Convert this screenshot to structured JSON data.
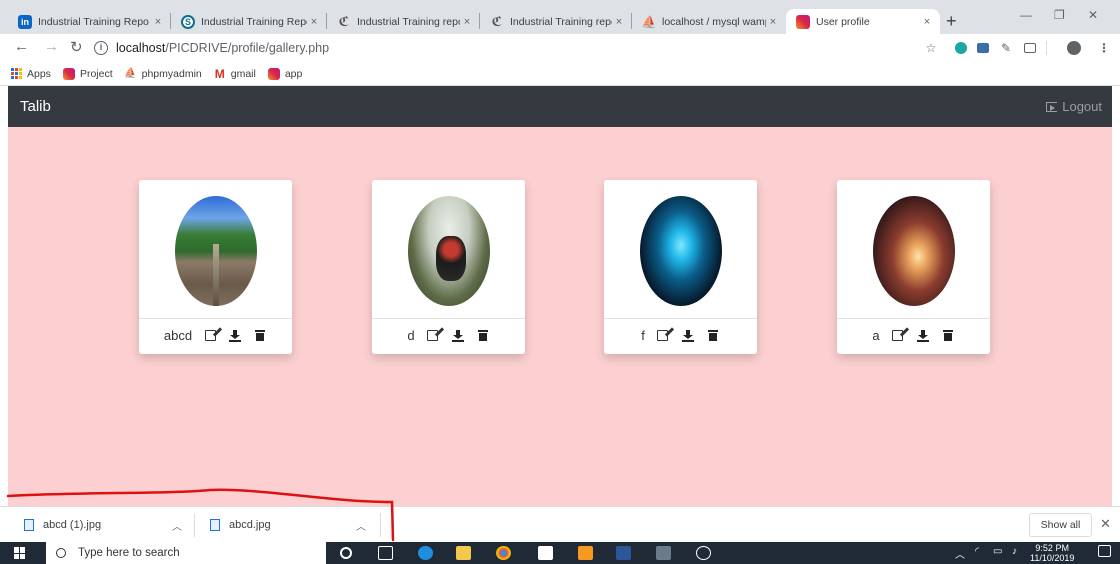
{
  "browser": {
    "tabs": [
      {
        "title": "Industrial Training Repo",
        "icon": "linkedin-icon"
      },
      {
        "title": "Industrial Training Repo",
        "icon": "s-icon"
      },
      {
        "title": "Industrial Training repo",
        "icon": "chegg-icon"
      },
      {
        "title": "Industrial Training repo",
        "icon": "chegg-icon"
      },
      {
        "title": "localhost / mysql wamp",
        "icon": "phpmyadmin-icon"
      },
      {
        "title": "User profile",
        "icon": "instagram-icon",
        "active": true
      }
    ],
    "address": {
      "host": "localhost",
      "path": "/PICDRIVE/profile/gallery.php"
    },
    "bookmarks": [
      "Apps",
      "Project",
      "phpmyadmin",
      "gmail",
      "app"
    ],
    "tab_close_glyph": "×",
    "new_tab_glyph": "+"
  },
  "page": {
    "brand": "Talib",
    "logout_label": "Logout",
    "background_color": "#fcd0d0",
    "navbar_color": "#343a40",
    "cards": [
      {
        "name": "abcd"
      },
      {
        "name": "d"
      },
      {
        "name": "f"
      },
      {
        "name": "a"
      }
    ]
  },
  "downloads": {
    "items": [
      {
        "file": "abcd (1).jpg"
      },
      {
        "file": "abcd.jpg"
      }
    ],
    "show_all_label": "Show all"
  },
  "taskbar": {
    "search_placeholder": "Type here to search",
    "time": "9:52 PM",
    "date": "11/10/2019"
  }
}
